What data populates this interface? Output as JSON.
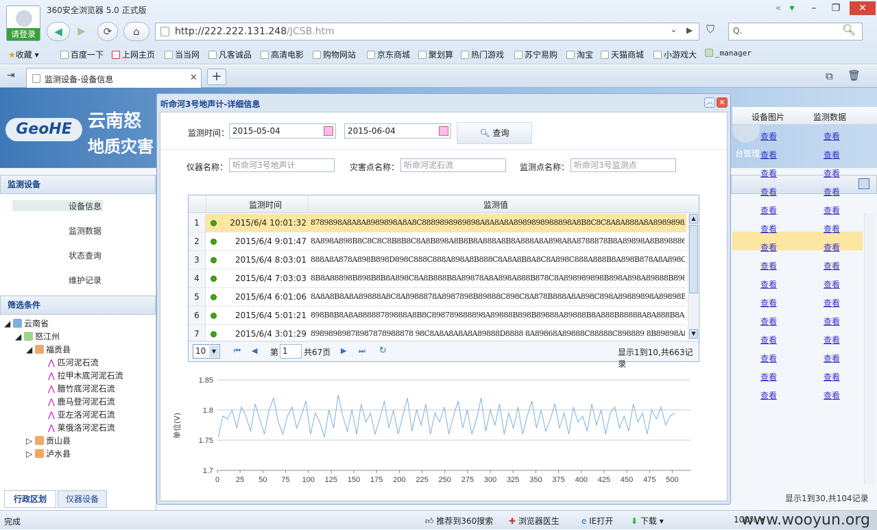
{
  "browser": {
    "title": "360安全浏览器 5.0 正式版",
    "login": "请登录",
    "address_host": "http://222.222.131.248",
    "address_path": "/JCSB.htm",
    "search_placeholder": "Q.",
    "window_controls": [
      "minimize-icon",
      "restore-icon",
      "close-icon"
    ]
  },
  "bookmarks": [
    "收藏",
    "百度一下",
    "上网主页",
    "当当网",
    "凡客诚品",
    "高清电影",
    "购物网站",
    "京东商城",
    "聚划算",
    "热门游戏",
    "苏宁易购",
    "淘宝",
    "天猫商城",
    "小游戏大",
    "_manager"
  ],
  "tab": {
    "label": "监测设备-设备信息",
    "new_tab": "+"
  },
  "banner": {
    "logo": "GeoHE",
    "line1": "云南怒",
    "line2": "地质灾害",
    "mgmt": "台管理"
  },
  "left_panel": {
    "header": "监测设备",
    "menu": [
      "设备信息",
      "监测数据",
      "状态查询",
      "维护记录"
    ],
    "filter_header": "筛选条件",
    "tree": [
      {
        "label": "云南省",
        "level": 0
      },
      {
        "label": "怒江州",
        "level": 1
      },
      {
        "label": "福贡县",
        "level": 2
      },
      {
        "label": "匹河泥石流",
        "level": 3
      },
      {
        "label": "拉甲木底河泥石流",
        "level": 3
      },
      {
        "label": "腊竹底河泥石流",
        "level": 3
      },
      {
        "label": "鹿马登河泥石流",
        "level": 3
      },
      {
        "label": "亚左洛河泥石流",
        "level": 3
      },
      {
        "label": "莱俄洛河泥石流",
        "level": 3
      },
      {
        "label": "贡山县",
        "level": 2
      },
      {
        "label": "泸水县",
        "level": 2
      }
    ],
    "bottom_tabs": [
      "行政区划",
      "仪器设备"
    ]
  },
  "right_grid": {
    "headers": [
      "设备图片",
      "监测数据"
    ],
    "link_text": "查看",
    "rows": 15,
    "footer": "显示1到30,共104记录"
  },
  "modal": {
    "title": "听命河3号地声计-详细信息",
    "query_label": "监测时间：",
    "start_date": "2015-05-04",
    "end_date": "2015-06-04",
    "query_button": "查询",
    "instrument_label": "仪器名称：",
    "instrument_value": "听命河3号地声计",
    "hazard_label": "灾害点名称：",
    "hazard_value": "听命河泥石流",
    "point_label": "监测点名称：",
    "point_value": "听命河3号监测点",
    "grid": {
      "col_time": "监测时间",
      "col_value": "监测值",
      "rows": [
        {
          "n": "1",
          "time": "2015/6/4 10:01:32",
          "value": "8789898A8A8A8989898A8A8C8889898989898A8A8A8A8989898988898A8B8C8C8A8A888A8A8989898A8A8A8A8A89",
          "selected": true
        },
        {
          "n": "2",
          "time": "2015/6/4 9:01:47",
          "value": "8A898A898B8C8C8C8B8B8C8A8B898A8B8B8A888A8B8A888A8A898A8A8788878B8A89898A8B898886"
        },
        {
          "n": "3",
          "time": "2015/6/4 8:03:01",
          "value": "888A8A878A898B898D898C888C888A898A8B888C8A8A8B8A8C8A898C888A888B8A898B878A8A898C8A8A"
        },
        {
          "n": "4",
          "time": "2015/6/4 7:03:03",
          "value": "8B8A88898B898B8B8A898C8A8B888B8A89878A8A898A888B878C8A898989898B898A898A89888B898A"
        },
        {
          "n": "5",
          "time": "2015/6/4 6:01:06",
          "value": "8A8A8B8A8A89888A8C8A8988878A8987898B89888C898C8A878B888A8A898C898A89889898A89898B8"
        },
        {
          "n": "6",
          "time": "2015/6/4 5:01:21",
          "value": "898B8B8A8A88888789888A8B8C898789888898A89888B898B89888A89888B8A888B88888A8A888B8A8"
        },
        {
          "n": "7",
          "time": "2015/6/4 3:01:29",
          "value": "89898989878987878988878 98C8A8A8A8A8A89888D8888 8A89868A89888C88888C898889 8B89898A8B898"
        }
      ]
    },
    "pager": {
      "page_size": "10",
      "page_prefix": "第",
      "page": "1",
      "page_total": "共67页",
      "summary": "显示1到10,共663记录"
    }
  },
  "chart_data": {
    "type": "line",
    "ylabel": "单位(V)",
    "ylim": [
      1.7,
      1.85
    ],
    "yticks": [
      1.85,
      1.8,
      1.75,
      1.7
    ],
    "xlim": [
      0,
      520
    ],
    "xticks": [
      0,
      25,
      50,
      75,
      100,
      125,
      150,
      175,
      200,
      225,
      250,
      275,
      300,
      325,
      350,
      375,
      400,
      425,
      450,
      475,
      500
    ],
    "grid": true,
    "series": [
      {
        "color": "#7aaee0",
        "values": [
          1.755,
          1.79,
          1.785,
          1.8,
          1.77,
          1.805,
          1.79,
          1.765,
          1.81,
          1.785,
          1.76,
          1.8,
          1.82,
          1.78,
          1.76,
          1.79,
          1.805,
          1.77,
          1.79,
          1.815,
          1.76,
          1.795,
          1.78,
          1.755,
          1.8,
          1.77,
          1.825,
          1.79,
          1.765,
          1.8,
          1.76,
          1.81,
          1.78,
          1.795,
          1.76,
          1.785,
          1.815,
          1.77,
          1.8,
          1.76,
          1.79,
          1.82,
          1.765,
          1.8,
          1.775,
          1.81,
          1.76,
          1.795,
          1.78,
          1.805,
          1.76,
          1.79,
          1.815,
          1.77,
          1.8,
          1.76,
          1.785,
          1.82,
          1.765,
          1.8,
          1.775,
          1.81,
          1.76,
          1.795,
          1.77,
          1.805,
          1.76,
          1.79,
          1.815,
          1.77,
          1.8,
          1.765,
          1.785,
          1.81,
          1.77,
          1.795,
          1.76,
          1.805,
          1.78,
          1.79,
          1.765,
          1.81,
          1.775,
          1.8,
          1.76,
          1.795,
          1.805,
          1.77,
          1.79,
          1.765,
          1.81,
          1.78,
          1.795,
          1.76,
          1.8,
          1.785,
          1.805,
          1.775,
          1.79,
          1.795
        ]
      }
    ]
  }
}
